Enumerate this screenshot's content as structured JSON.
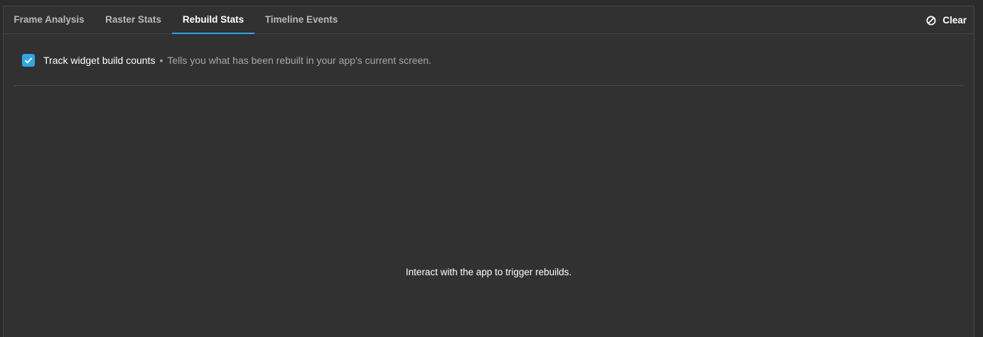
{
  "tabs": {
    "frame_analysis": "Frame Analysis",
    "raster_stats": "Raster Stats",
    "rebuild_stats": "Rebuild Stats",
    "timeline_events": "Timeline Events",
    "active": "Rebuild Stats"
  },
  "toolbar": {
    "clear_label": "Clear",
    "clear_icon": "block-icon"
  },
  "option": {
    "checked": true,
    "label": "Track widget build counts",
    "separator": "•",
    "description": "Tells you what has been rebuilt in your app's current screen."
  },
  "main": {
    "empty_message": "Interact with the app to trigger rebuilds."
  },
  "colors": {
    "accent": "#2ea6e6",
    "background": "#313131",
    "text": "#ffffff",
    "muted_text": "#a8a8a8"
  }
}
